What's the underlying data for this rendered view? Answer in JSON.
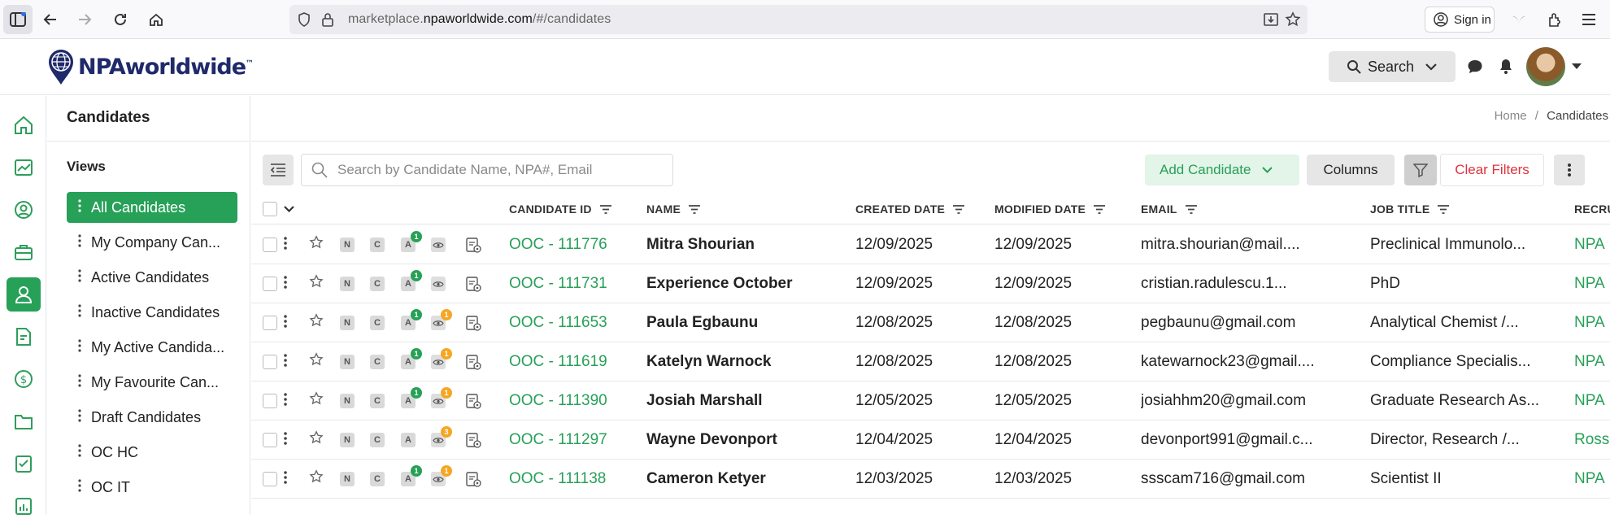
{
  "browser": {
    "url_prefix": "marketplace.",
    "url_host": "npaworldwide.com",
    "url_path": "/#/candidates",
    "signin_label": "Sign in"
  },
  "header": {
    "logo_text": "NPAworldwide",
    "logo_tm": "™",
    "search_label": "Search"
  },
  "panel": {
    "title": "Candidates",
    "views_label": "Views",
    "views": [
      {
        "label": "All Candidates",
        "active": true
      },
      {
        "label": "My Company Can..."
      },
      {
        "label": "Active Candidates"
      },
      {
        "label": "Inactive Candidates"
      },
      {
        "label": "My Active Candida..."
      },
      {
        "label": "My Favourite Can..."
      },
      {
        "label": "Draft Candidates"
      },
      {
        "label": "OC HC"
      },
      {
        "label": "OC IT"
      }
    ]
  },
  "main": {
    "breadcrumb_home": "Home",
    "breadcrumb_sep": "/",
    "breadcrumb_current": "Candidates",
    "search_placeholder": "Search by Candidate Name, NPA#, Email",
    "add_label": "Add Candidate",
    "columns_label": "Columns",
    "clear_label": "Clear Filters"
  },
  "table": {
    "headers": {
      "id": "CANDIDATE ID",
      "name": "NAME",
      "created": "CREATED DATE",
      "modified": "MODIFIED DATE",
      "email": "EMAIL",
      "job": "JOB TITLE",
      "recruiter": "RECRU"
    },
    "tag_labels": {
      "n": "N",
      "c": "C",
      "a": "A"
    },
    "rows": [
      {
        "id": "OOC - 111776",
        "name": "Mitra Shourian",
        "created": "12/09/2025",
        "modified": "12/09/2025",
        "email": "mitra.shourian@mail....",
        "job": "Preclinical Immunolo...",
        "recruiter": "NPA",
        "a_badge": "1",
        "eye_badge": ""
      },
      {
        "id": "OOC - 111731",
        "name": "Experience October",
        "created": "12/09/2025",
        "modified": "12/09/2025",
        "email": "cristian.radulescu.1...",
        "job": "PhD",
        "recruiter": "NPA",
        "a_badge": "1",
        "eye_badge": ""
      },
      {
        "id": "OOC - 111653",
        "name": "Paula Egbaunu",
        "created": "12/08/2025",
        "modified": "12/08/2025",
        "email": "pegbaunu@gmail.com",
        "job": "Analytical Chemist /...",
        "recruiter": "NPA",
        "a_badge": "1",
        "eye_badge": "1"
      },
      {
        "id": "OOC - 111619",
        "name": "Katelyn Warnock",
        "created": "12/08/2025",
        "modified": "12/08/2025",
        "email": "katewarnock23@gmail....",
        "job": "Compliance Specialis...",
        "recruiter": "NPA",
        "a_badge": "1",
        "eye_badge": "1"
      },
      {
        "id": "OOC - 111390",
        "name": "Josiah Marshall",
        "created": "12/05/2025",
        "modified": "12/05/2025",
        "email": "josiahhm20@gmail.com",
        "job": "Graduate Research As...",
        "recruiter": "NPA",
        "a_badge": "1",
        "eye_badge": "1"
      },
      {
        "id": "OOC - 111297",
        "name": "Wayne Devonport",
        "created": "12/04/2025",
        "modified": "12/04/2025",
        "email": "devonport991@gmail.c...",
        "job": "Director, Research /...",
        "recruiter": "Ross",
        "a_badge": "",
        "eye_badge": "3"
      },
      {
        "id": "OOC - 111138",
        "name": "Cameron Ketyer",
        "created": "12/03/2025",
        "modified": "12/03/2025",
        "email": "ssscam716@gmail.com",
        "job": "Scientist II",
        "recruiter": "NPA",
        "a_badge": "1",
        "eye_badge": "1"
      }
    ]
  },
  "colors": {
    "accent_green": "#27a058",
    "badge_orange": "#f5a623",
    "clear_red": "#e0323c",
    "logo_navy": "#1f2a6b"
  },
  "icons": [
    "sidebar-toggle-icon",
    "back-icon",
    "forward-icon",
    "reload-icon",
    "home-icon",
    "shield-icon",
    "lock-icon",
    "download-icon",
    "bookmark-star-icon",
    "account-icon",
    "extension-icon",
    "search-icon",
    "chevron-down-icon",
    "chat-icon",
    "bell-icon",
    "filter-icon",
    "star-icon",
    "eye-icon",
    "profile-card-icon"
  ]
}
